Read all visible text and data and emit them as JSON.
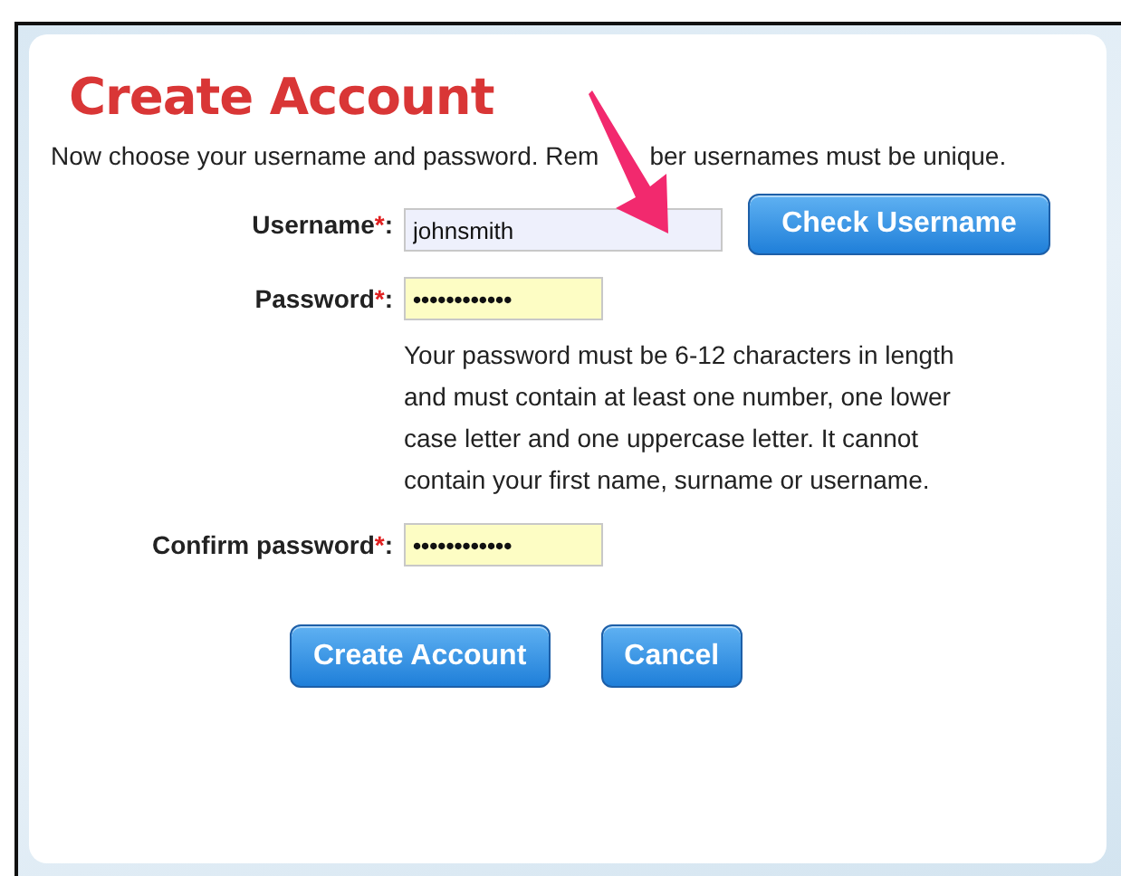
{
  "title": "Create Account",
  "intro": [
    "Now choose your username and password. Rem",
    "ber usernames must be unique."
  ],
  "fields": [
    {
      "label": "Username",
      "mark": "*",
      "colon": ":",
      "value": "johnsmith",
      "kind": "text",
      "button": "Check Username"
    },
    {
      "label": "Password",
      "mark": "*",
      "colon": ":",
      "value": "••••••••••••",
      "kind": "secret",
      "help": "Your password must be 6-12 characters in length and must contain at least one number, one lower case letter and one uppercase letter. It cannot contain your first name, surname or username."
    },
    {
      "label": "Confirm password",
      "mark": "*",
      "colon": ":",
      "value": "••••••••••••",
      "kind": "secret"
    }
  ],
  "buttons": [
    "Create Account",
    "Cancel"
  ]
}
